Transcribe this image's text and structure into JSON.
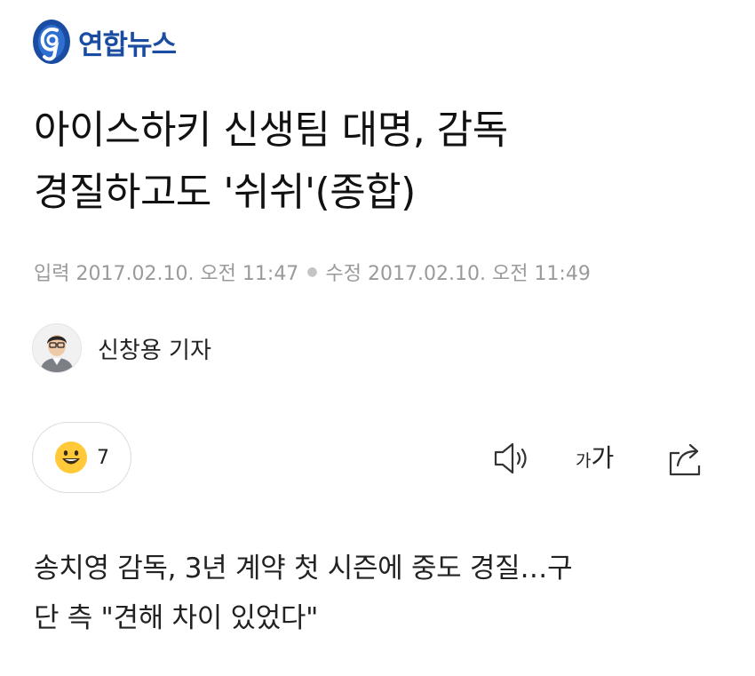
{
  "brand": {
    "name": "연합뉴스",
    "logo_color": "#1a4da1"
  },
  "article": {
    "title_line1": "아이스하키 신생팀 대명, 감독",
    "title_line2": "경질하고도 '쉬쉬'(종합)",
    "input_label": "입력",
    "input_time": "2017.02.10. 오전 11:47",
    "edit_label": "수정",
    "edit_time": "2017.02.10. 오전 11:49",
    "reporter": "신창용 기자",
    "summary_line1": "송치영 감독, 3년 계약 첫 시즌에 중도 경질…구",
    "summary_line2": "단 측 \"견해 차이 있었다\""
  },
  "reaction": {
    "icon": "smiley-face-icon",
    "count": "7"
  },
  "toolbar": {
    "speaker_icon": "speaker-icon",
    "font_small": "가",
    "font_large": "가",
    "share_icon": "share-icon"
  }
}
